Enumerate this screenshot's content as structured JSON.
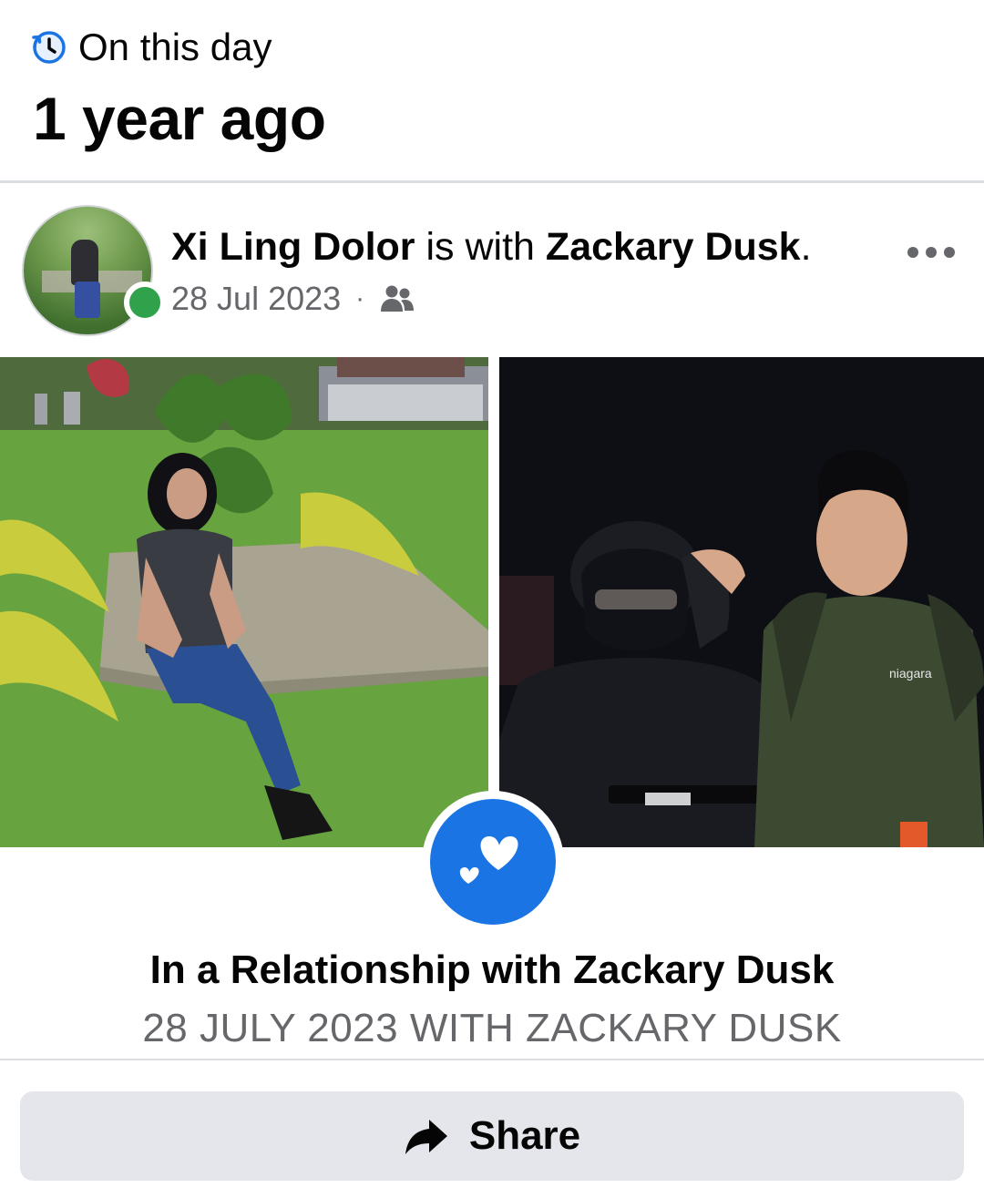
{
  "memory": {
    "label": "On this day",
    "title": "1 year ago",
    "icon": "history-clock-icon",
    "icon_color": "#1b74e4"
  },
  "post": {
    "author": "Xi Ling Dolor",
    "with_text": " is with ",
    "tagged": "Zackary Dusk",
    "end_punct": ".",
    "date": "28 Jul 2023",
    "separator": "·",
    "audience_icon": "friends-icon",
    "online_status_color": "#31a24c",
    "more_icon": "more-horizontal-icon"
  },
  "life_event": {
    "icon": "hearts-icon",
    "title": "In a Relationship with Zackary Dusk",
    "subtitle": "28 JULY 2023 WITH ZACKARY DUSK",
    "badge_color": "#1b74e4"
  },
  "share": {
    "label": "Share",
    "icon": "share-arrow-icon"
  },
  "photos": {
    "right_shirt_logo": "niagara"
  }
}
